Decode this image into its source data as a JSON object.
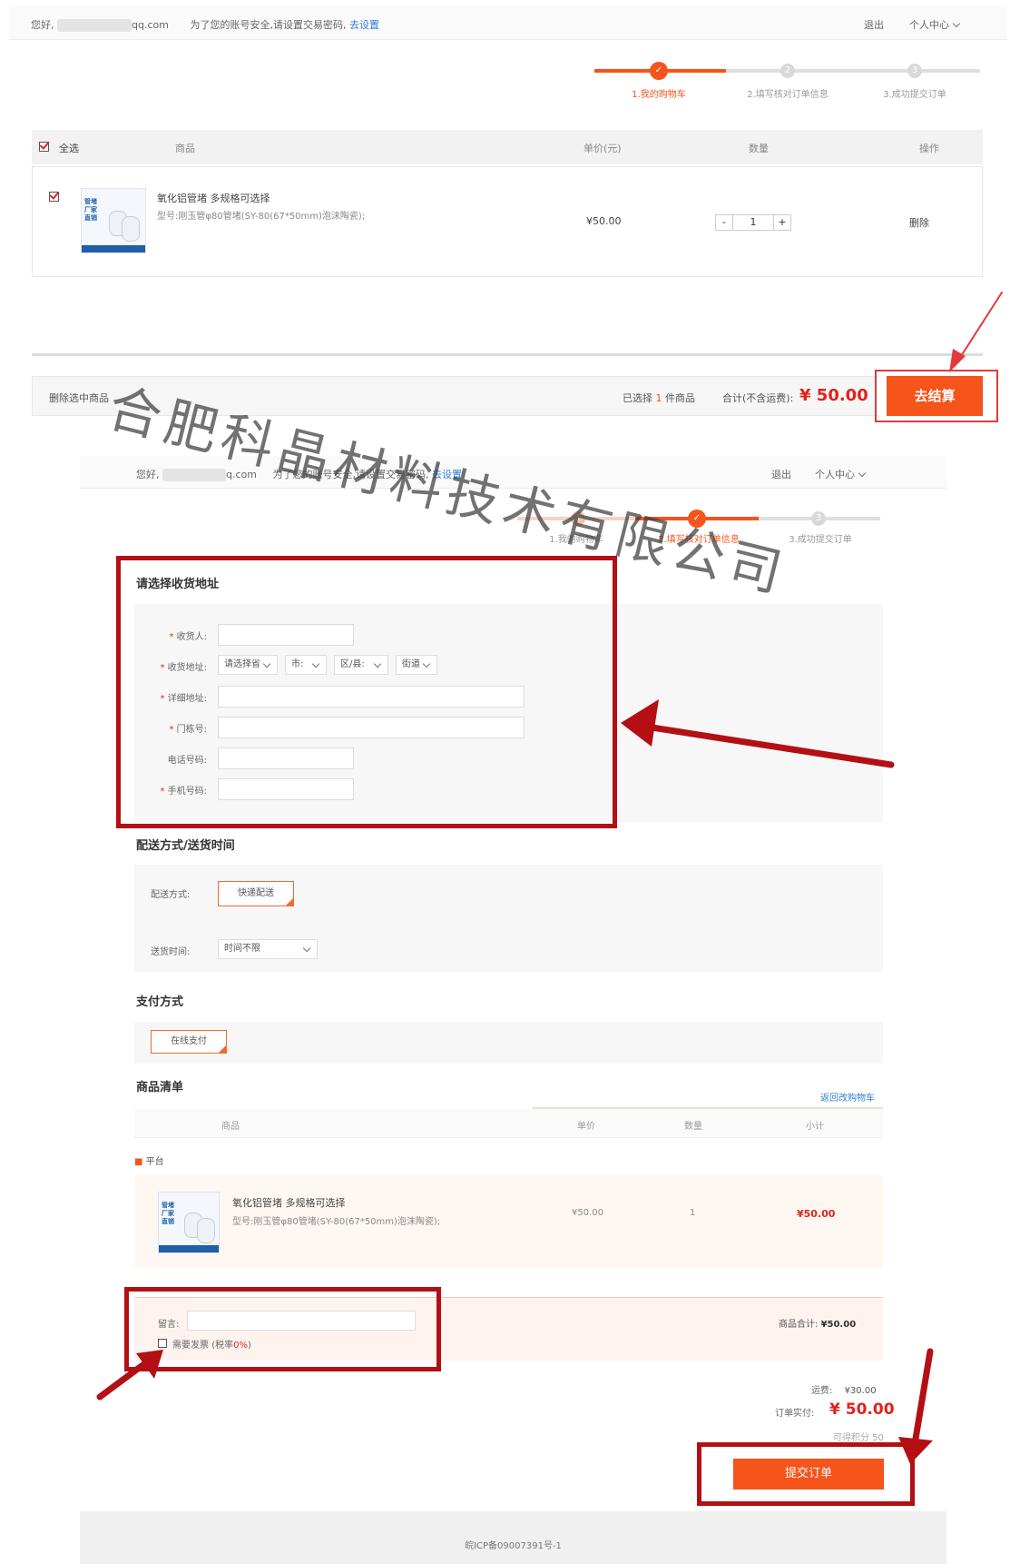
{
  "top1": {
    "greeting": "您好,",
    "email_suffix": "qq.com",
    "security_msg": "为了您的账号安全,请设置交易密码,",
    "set_link": "去设置",
    "logout": "退出",
    "center": "个人中心"
  },
  "steps": [
    {
      "label": "1.我的购物车",
      "num": "1"
    },
    {
      "label": "2.填写核对订单信息",
      "num": "2"
    },
    {
      "label": "3.成功提交订单",
      "num": "3"
    }
  ],
  "cart": {
    "headers": {
      "select_all": "全选",
      "product": "商品",
      "unit_price": "单价(元)",
      "qty": "数量",
      "op": "操作"
    },
    "item": {
      "name": "氧化铝管堵 多规格可选择",
      "model": "型号:刚玉管φ80管堵(SY-80(67*50mm)泡沫陶瓷);",
      "price": "¥50.00",
      "qty": "1",
      "minus": "-",
      "plus": "+",
      "delete": "删除",
      "thumb_text": [
        "管堵",
        "厂家",
        "直销"
      ]
    },
    "footer": {
      "delete_selected": "删除选中商品",
      "selected_prefix": "已选择",
      "selected_count": "1",
      "selected_suffix": "件商品",
      "total_label": "合计(不含运费):",
      "total_value": "¥ 50.00",
      "checkout": "去结算"
    }
  },
  "top2": {
    "greeting": "您好,",
    "email_suffix": "q.com",
    "security_msg": "为了您的账号安全,请设置交易密码,",
    "set_link": "去设置",
    "logout": "退出",
    "center": "个人中心"
  },
  "steps2": [
    {
      "label": "1.我的购物车",
      "num": "1"
    },
    {
      "label": "2.填写核对订单信息",
      "num": "2"
    },
    {
      "label": "3.成功提交订单",
      "num": "3"
    }
  ],
  "address": {
    "title": "请选择收货地址",
    "receiver": "收货人:",
    "region": "收货地址:",
    "province": "请选择省",
    "city": "市:",
    "district": "区/县:",
    "street": "街道",
    "detail": "详细地址:",
    "door": "门栋号:",
    "phone": "电话号码:",
    "mobile": "手机号码:"
  },
  "delivery": {
    "title": "配送方式/送货时间",
    "method_label": "配送方式:",
    "method_value": "快递配送",
    "time_label": "送货时间:",
    "time_value": "时间不限"
  },
  "payment": {
    "title": "支付方式",
    "value": "在线支付"
  },
  "list": {
    "title": "商品清单",
    "back_link": "返回改购物车",
    "headers": {
      "product": "商品",
      "price": "单价",
      "qty": "数量",
      "subtotal": "小计"
    },
    "shop": "平台",
    "item": {
      "name": "氧化铝管堵 多规格可选择",
      "model": "型号:刚玉管φ80管堵(SY-80(67*50mm)泡沫陶瓷);",
      "price": "¥50.00",
      "qty": "1",
      "subtotal": "¥50.00"
    },
    "message_label": "留言:",
    "invoice_label": "需要发票",
    "invoice_rate_prefix": "(税率",
    "invoice_rate": "0%",
    "invoice_rate_suffix": ")",
    "goods_total_label": "商品合计:",
    "goods_total": "¥50.00"
  },
  "summary": {
    "freight_label": "运费:",
    "freight": "¥30.00",
    "pay_label": "订单实付:",
    "pay_value": "¥ 50.00",
    "points": "可得积分 50",
    "submit": "提交订单"
  },
  "footer": {
    "icp": "皖ICP备09007391号-1"
  },
  "watermark": "合肥科晶材料技术有限公司",
  "colors": {
    "accent": "#f5541b",
    "annotation_red": "#b40f14"
  }
}
